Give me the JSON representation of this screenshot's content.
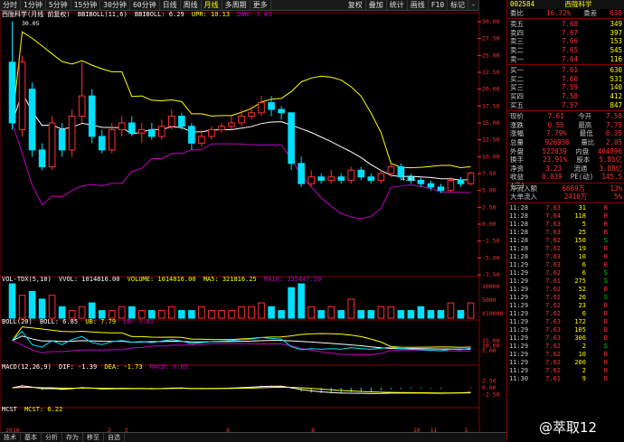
{
  "toolbar": {
    "items": [
      "分时",
      "1分钟",
      "5分钟",
      "15分钟",
      "30分钟",
      "60分钟",
      "日线",
      "周线",
      "月线",
      "多周期",
      "更多"
    ],
    "active_index": 8,
    "right_items": [
      "复权",
      "叠加",
      "统计",
      "画线",
      "F10",
      "标记",
      "-"
    ]
  },
  "main_panel": {
    "stock_label": "西陇科学(月线 前复权)",
    "indicator": "BBIBOLL(11,6)",
    "bbiboll_label": "BBIBOLL: 6.29",
    "upr_label": "UPR: 10.13",
    "dwn_label": "DWN: 3.43",
    "max_price_label": "30.05",
    "min_price_label": "4.61",
    "y_ticks": [
      "30.00",
      "27.50",
      "25.00",
      "22.50",
      "20.00",
      "17.50",
      "15.00",
      "12.50",
      "10.00",
      "7.50",
      "5.00",
      "2.50",
      "0.00",
      "-2.50",
      "-5.00",
      "-7.50"
    ]
  },
  "vol_panel": {
    "label": "VOL-TDX(5,10)",
    "vvol": "VVOL: 1014816.00",
    "volume": "VOLUME: 1014816.00",
    "ma5": "MA5: 321816.25",
    "ma10": "MA10: 355447.50",
    "y_ticks": [
      "10000",
      "5000",
      "X10000"
    ]
  },
  "boll_panel": {
    "label": "BOLL(20)",
    "boll": "BOLL: 6.85",
    "ub": "UB: 7.79",
    "lb": "LB: 3.81",
    "y_ticks": [
      "15.00",
      "10.00",
      "5.00"
    ]
  },
  "macd_panel": {
    "label": "MACD(12,26,9)",
    "dif": "DIF: -1.39",
    "dea": "DEA: -1.73",
    "macd": "MACD: 0.65",
    "y_ticks": [
      "2.50",
      "0.00",
      "-2.50"
    ]
  },
  "mcst_panel": {
    "label": "MCST",
    "mcst": "MCST: 6.22"
  },
  "x_axis": [
    "2010",
    "",
    "",
    "",
    "",
    "",
    "2",
    "3",
    "",
    "",
    "",
    "",
    "",
    "6",
    "",
    "",
    "",
    "",
    "8",
    "",
    "",
    "",
    "",
    "",
    "10",
    "11",
    "",
    "1"
  ],
  "bottombar": [
    "技术",
    "基本",
    "分析",
    "存为",
    "移至",
    "自选"
  ],
  "quote": {
    "code": "002584",
    "name": "西陇科学",
    "ratio_label": "委比",
    "ratio_pct": "16.72%",
    "diff_label": "委差",
    "diff_val": "638",
    "asks": [
      {
        "label": "卖五",
        "price": "7.68",
        "vol": "349"
      },
      {
        "label": "卖四",
        "price": "7.67",
        "vol": "397"
      },
      {
        "label": "卖三",
        "price": "7.66",
        "vol": "153"
      },
      {
        "label": "卖二",
        "price": "7.65",
        "vol": "545"
      },
      {
        "label": "卖一",
        "price": "7.64",
        "vol": "116"
      }
    ],
    "bids": [
      {
        "label": "买一",
        "price": "7.61",
        "vol": "630"
      },
      {
        "label": "买二",
        "price": "7.60",
        "vol": "531"
      },
      {
        "label": "买三",
        "price": "7.59",
        "vol": "140"
      },
      {
        "label": "买四",
        "price": "7.58",
        "vol": "412"
      },
      {
        "label": "买五",
        "price": "7.57",
        "vol": "847"
      }
    ],
    "stats": [
      {
        "l1": "现价",
        "v1": "7.61",
        "l2": "今开",
        "v2": "7.58"
      },
      {
        "l1": "涨跌",
        "v1": "0.55",
        "l2": "最高",
        "v2": "7.75"
      },
      {
        "l1": "涨幅",
        "v1": "7.79%",
        "l2": "最低",
        "v2": "6.35"
      },
      {
        "l1": "总量",
        "v1": "926936",
        "l2": "量比",
        "v2": "2.05"
      },
      {
        "l1": "外盘",
        "v1": "522039",
        "l2": "内盘",
        "v2": "404896"
      },
      {
        "l1": "换手",
        "v1": "23.91%",
        "l2": "股本",
        "v2": "5.85亿"
      },
      {
        "l1": "净资",
        "v1": "3.23",
        "l2": "流通",
        "v2": "3.88亿"
      },
      {
        "l1": "收益(三)",
        "v1": "0.039",
        "l2": "PE(动)",
        "v2": "145.5"
      }
    ],
    "netflow": [
      {
        "label": "净流入额",
        "val": "6669万",
        "pct": "13%"
      },
      {
        "label": "大单流入",
        "val": "2410万",
        "pct": "5%"
      }
    ],
    "ticks": [
      {
        "t": "11:28",
        "p": "7.63",
        "v": "31",
        "f": "B"
      },
      {
        "t": "11:28",
        "p": "7.64",
        "v": "118",
        "f": "B"
      },
      {
        "t": "11:28",
        "p": "7.63",
        "v": "5",
        "f": "B"
      },
      {
        "t": "11:28",
        "p": "7.63",
        "v": "25",
        "f": "B"
      },
      {
        "t": "11:28",
        "p": "7.62",
        "v": "150",
        "f": "S"
      },
      {
        "t": "11:28",
        "p": "7.62",
        "v": "19",
        "f": "B"
      },
      {
        "t": "11:28",
        "p": "7.63",
        "v": "10",
        "f": "B"
      },
      {
        "t": "11:29",
        "p": "7.63",
        "v": "6",
        "f": "B"
      },
      {
        "t": "11:29",
        "p": "7.62",
        "v": "6",
        "f": "S"
      },
      {
        "t": "11:29",
        "p": "7.61",
        "v": "275",
        "f": "S"
      },
      {
        "t": "11:29",
        "p": "7.62",
        "v": "52",
        "f": "B"
      },
      {
        "t": "11:29",
        "p": "7.62",
        "v": "26",
        "f": "S"
      },
      {
        "t": "11:29",
        "p": "7.62",
        "v": "23",
        "f": "B"
      },
      {
        "t": "11:29",
        "p": "7.62",
        "v": "6",
        "f": "B"
      },
      {
        "t": "11:29",
        "p": "7.63",
        "v": "172",
        "f": "B"
      },
      {
        "t": "11:29",
        "p": "7.63",
        "v": "105",
        "f": "B"
      },
      {
        "t": "11:29",
        "p": "7.63",
        "v": "306",
        "f": "B"
      },
      {
        "t": "11:29",
        "p": "7.62",
        "v": "2",
        "f": "S"
      },
      {
        "t": "11:29",
        "p": "7.62",
        "v": "10",
        "f": "B"
      },
      {
        "t": "11:29",
        "p": "7.62",
        "v": "200",
        "f": "B"
      },
      {
        "t": "11:29",
        "p": "7.62",
        "v": "2",
        "f": "B"
      },
      {
        "t": "11:30",
        "p": "7.61",
        "v": "9",
        "f": "B"
      }
    ]
  },
  "watermark": "@萃取12",
  "colors": {
    "up": "#ff3030",
    "down": "#00e0ff",
    "ma_yellow": "#ffff00",
    "ma_purple": "#c000c0",
    "ma_white": "#ffffff",
    "ma_cyan": "#00c0c0"
  },
  "chart_data": {
    "type": "candlestick",
    "ylim": [
      -7.5,
      30
    ],
    "candles": [
      {
        "o": 24,
        "c": 15,
        "h": 30.05,
        "l": 14
      },
      {
        "o": 14,
        "c": 24,
        "h": 25,
        "l": 13
      },
      {
        "o": 20,
        "c": 11,
        "h": 21,
        "l": 10
      },
      {
        "o": 11,
        "c": 8.5,
        "h": 12,
        "l": 8
      },
      {
        "o": 8.5,
        "c": 15,
        "h": 16,
        "l": 8
      },
      {
        "o": 14,
        "c": 11,
        "h": 15,
        "l": 10
      },
      {
        "o": 11,
        "c": 16,
        "h": 17,
        "l": 10
      },
      {
        "o": 16,
        "c": 19,
        "h": 24,
        "l": 15
      },
      {
        "o": 19,
        "c": 13,
        "h": 20,
        "l": 12
      },
      {
        "o": 13,
        "c": 11,
        "h": 14,
        "l": 10.5
      },
      {
        "o": 11,
        "c": 14,
        "h": 15,
        "l": 10.5
      },
      {
        "o": 14,
        "c": 15,
        "h": 16,
        "l": 13
      },
      {
        "o": 15,
        "c": 13.5,
        "h": 16,
        "l": 13
      },
      {
        "o": 13.5,
        "c": 14,
        "h": 15,
        "l": 12
      },
      {
        "o": 14,
        "c": 13,
        "h": 15,
        "l": 12.5
      },
      {
        "o": 13,
        "c": 14.5,
        "h": 15.5,
        "l": 12.5
      },
      {
        "o": 14.5,
        "c": 16,
        "h": 17,
        "l": 14
      },
      {
        "o": 16,
        "c": 14.5,
        "h": 16.5,
        "l": 14
      },
      {
        "o": 14.5,
        "c": 12,
        "h": 15,
        "l": 11
      },
      {
        "o": 12,
        "c": 13,
        "h": 14,
        "l": 11.5
      },
      {
        "o": 13,
        "c": 14,
        "h": 14.5,
        "l": 12.5
      },
      {
        "o": 14,
        "c": 14.5,
        "h": 15,
        "l": 13.5
      },
      {
        "o": 14.5,
        "c": 15,
        "h": 16,
        "l": 14
      },
      {
        "o": 15,
        "c": 16,
        "h": 17,
        "l": 14.5
      },
      {
        "o": 16,
        "c": 16.5,
        "h": 17.5,
        "l": 15.5
      },
      {
        "o": 16.5,
        "c": 18,
        "h": 19,
        "l": 16
      },
      {
        "o": 18,
        "c": 17,
        "h": 19,
        "l": 16
      },
      {
        "o": 17,
        "c": 16.5,
        "h": 17.5,
        "l": 15.5
      },
      {
        "o": 16.5,
        "c": 9,
        "h": 16,
        "l": 8
      },
      {
        "o": 9,
        "c": 6,
        "h": 10,
        "l": 5.5
      },
      {
        "o": 6,
        "c": 7,
        "h": 8,
        "l": 5.5
      },
      {
        "o": 7,
        "c": 6.5,
        "h": 7.5,
        "l": 6
      },
      {
        "o": 6.5,
        "c": 7,
        "h": 8,
        "l": 6
      },
      {
        "o": 7,
        "c": 6.5,
        "h": 7.5,
        "l": 6
      },
      {
        "o": 6.5,
        "c": 8,
        "h": 8.5,
        "l": 6
      },
      {
        "o": 8,
        "c": 7,
        "h": 8.5,
        "l": 6.5
      },
      {
        "o": 7,
        "c": 6.5,
        "h": 7.5,
        "l": 6
      },
      {
        "o": 6.5,
        "c": 7.5,
        "h": 8,
        "l": 6
      },
      {
        "o": 7.5,
        "c": 8.5,
        "h": 9,
        "l": 7
      },
      {
        "o": 8.5,
        "c": 7,
        "h": 9,
        "l": 6.5
      },
      {
        "o": 7,
        "c": 6.5,
        "h": 7.5,
        "l": 6
      },
      {
        "o": 6.5,
        "c": 6,
        "h": 7,
        "l": 5.5
      },
      {
        "o": 6,
        "c": 5.5,
        "h": 6.5,
        "l": 5
      },
      {
        "o": 5.5,
        "c": 5,
        "h": 6,
        "l": 4.61
      },
      {
        "o": 5,
        "c": 6.5,
        "h": 7,
        "l": 4.8
      },
      {
        "o": 6.5,
        "c": 6,
        "h": 7,
        "l": 5.5
      },
      {
        "o": 6,
        "c": 7.6,
        "h": 7.75,
        "l": 5.8
      }
    ],
    "volumes": [
      9,
      6,
      7,
      5,
      6,
      3,
      2,
      3,
      4,
      2,
      2,
      3,
      3,
      2,
      2,
      2,
      3,
      2,
      2,
      3,
      2,
      2,
      2,
      3,
      3,
      4,
      3,
      2,
      8,
      9,
      3,
      2,
      3,
      2,
      5,
      2,
      2,
      3,
      3,
      2,
      2,
      3,
      2,
      2,
      4,
      2,
      4
    ]
  }
}
